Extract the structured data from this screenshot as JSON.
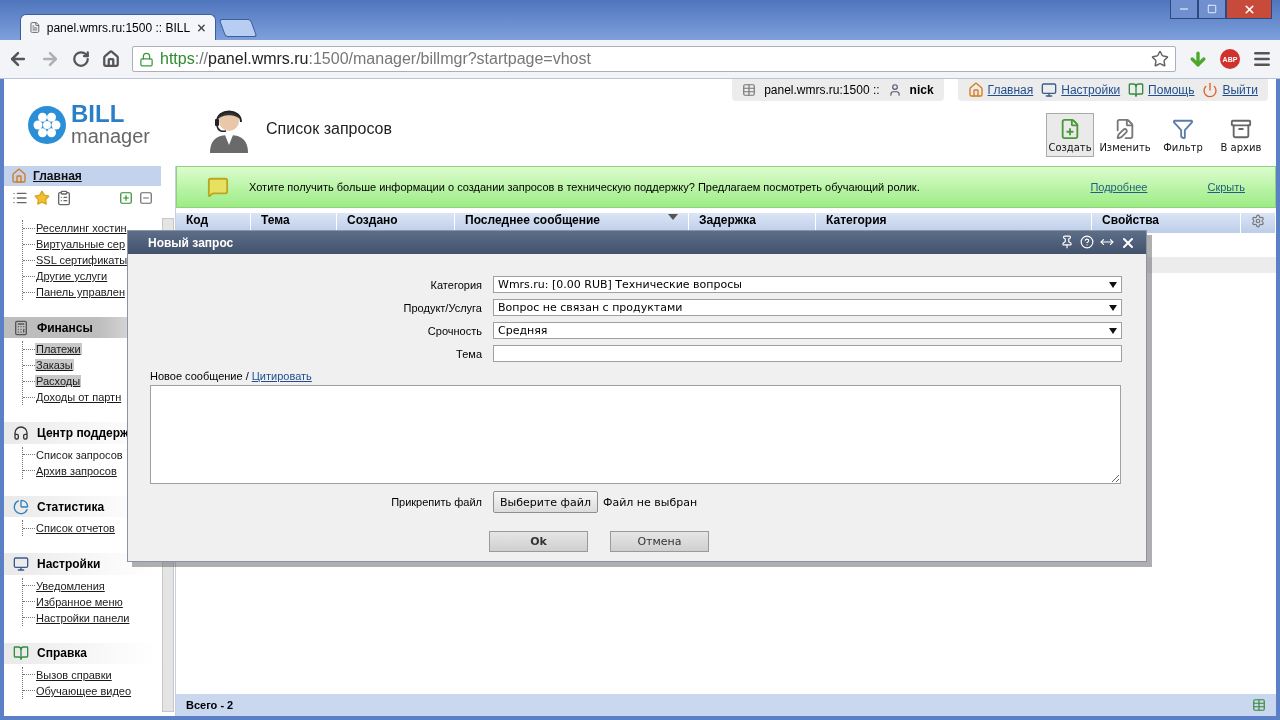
{
  "browser": {
    "tabs": [
      {
        "title": "panel.wmrs.ru:1500 :: BILL",
        "selected": true
      }
    ],
    "url": {
      "scheme": "https",
      "separator": "://",
      "host": "panel.wmrs.ru",
      "rest": ":1500/manager/billmgr?startpage=vhost"
    },
    "forward_disabled": true,
    "abp_badge": "ABP"
  },
  "logo": {
    "line1": "BILL",
    "line2": "manager"
  },
  "page_title": "Список запросов",
  "session": {
    "host": "panel.wmrs.ru:1500 ::",
    "user": "nick"
  },
  "top_links": [
    {
      "label": "Главная",
      "kind": "home"
    },
    {
      "label": "Настройки",
      "kind": "settings"
    },
    {
      "label": "Помощь",
      "kind": "help"
    },
    {
      "label": "Выйти",
      "kind": "exit"
    }
  ],
  "toolbar": [
    {
      "label": "Создать",
      "kind": "create",
      "selected": true
    },
    {
      "label": "Изменить",
      "kind": "edit",
      "selected": false
    },
    {
      "label": "Фильтр",
      "kind": "filter",
      "selected": false
    },
    {
      "label": "В архив",
      "kind": "archive",
      "selected": false
    }
  ],
  "sidebar": {
    "home": "Главная",
    "services": [
      {
        "label": "Реселлинг хостин"
      },
      {
        "label": "Виртуальные сер"
      },
      {
        "label": "SSL сертификаты"
      },
      {
        "label": "Другие услуги"
      },
      {
        "label": "Панель управлен"
      }
    ],
    "groups": [
      {
        "title": "Финансы",
        "kind": "finance",
        "highlighted": true,
        "items": [
          {
            "label": "Платежи",
            "highlighted": true,
            "current": false
          },
          {
            "label": "Заказы",
            "highlighted": true,
            "current": false
          },
          {
            "label": "Расходы",
            "highlighted": true,
            "current": false
          },
          {
            "label": "Доходы от партн",
            "highlighted": false,
            "current": false
          }
        ]
      },
      {
        "title": "Центр поддерж",
        "kind": "support",
        "highlighted": false,
        "items": [
          {
            "label": "Список запросов",
            "highlighted": false,
            "current": true
          },
          {
            "label": "Архив запросов",
            "highlighted": false,
            "current": false
          }
        ]
      },
      {
        "title": "Статистика",
        "kind": "stats",
        "highlighted": false,
        "items": [
          {
            "label": "Список отчетов",
            "highlighted": false,
            "current": false
          }
        ]
      },
      {
        "title": "Настройки",
        "kind": "settings",
        "highlighted": false,
        "items": [
          {
            "label": "Уведомления",
            "highlighted": false,
            "current": false
          },
          {
            "label": "Избранное меню",
            "highlighted": false,
            "current": false
          },
          {
            "label": "Настройки панели",
            "highlighted": false,
            "current": false
          }
        ]
      },
      {
        "title": "Справка",
        "kind": "help",
        "highlighted": false,
        "items": [
          {
            "label": "Вызов справки",
            "highlighted": false,
            "current": false
          },
          {
            "label": "Обучающее видео",
            "highlighted": false,
            "current": false
          }
        ]
      }
    ]
  },
  "banner": {
    "text": "Хотите получить больше информации о создании запросов в техническую поддержку? Предлагаем посмотреть обучающий ролик.",
    "links": [
      "Подробнее",
      "Скрыть"
    ]
  },
  "table": {
    "columns": [
      {
        "label": "Код",
        "sorted": false
      },
      {
        "label": "Тема",
        "sorted": false
      },
      {
        "label": "Создано",
        "sorted": false
      },
      {
        "label": "Последнее сообщение",
        "sorted": true
      },
      {
        "label": "Задержка",
        "sorted": false
      },
      {
        "label": "Категория",
        "sorted": false
      },
      {
        "label": "Свойства",
        "sorted": false
      }
    ],
    "footer": "Всего - 2"
  },
  "dialog": {
    "title": "Новый запрос",
    "fields": [
      {
        "label": "Категория",
        "kind": "select",
        "value": "Wmrs.ru: [0.00 RUB] Технические вопросы"
      },
      {
        "label": "Продукт/Услуга",
        "kind": "select",
        "value": "Вопрос не связан с продуктами"
      },
      {
        "label": "Срочность",
        "kind": "select",
        "value": "Средняя"
      },
      {
        "label": "Тема",
        "kind": "text"
      }
    ],
    "message_label": "Новое сообщение /",
    "quote_link": "Цитировать",
    "attach_label": "Прикрепить файл",
    "file_button": "Выберите файл",
    "file_status": "Файл не выбран",
    "buttons": [
      {
        "label": "Ok",
        "kind": "primary"
      },
      {
        "label": "Отмена",
        "kind": "secondary"
      }
    ]
  }
}
